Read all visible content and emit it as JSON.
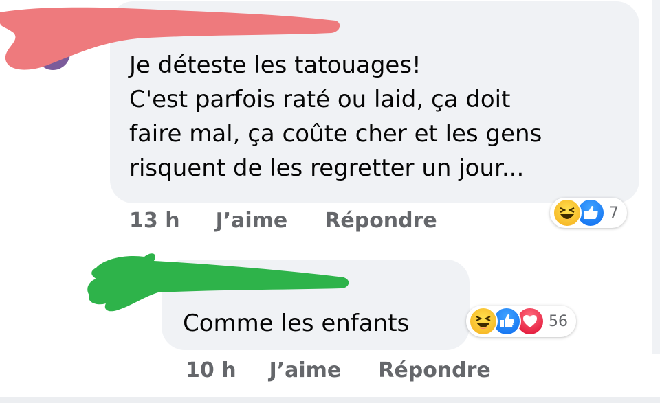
{
  "comments": [
    {
      "text": "Je déteste les tatouages!\nC'est parfois raté ou laid, ça doit\nfaire mal, ça coûte cher et les gens\nrisquent de les regretter un jour...",
      "time": "13 h",
      "like_label": "J’aime",
      "reply_label": "Répondre",
      "reactions": [
        "haha",
        "like"
      ],
      "reaction_count": "7"
    },
    {
      "text": "Comme les enfants",
      "time": "10 h",
      "like_label": "J’aime",
      "reply_label": "Répondre",
      "reactions": [
        "haha",
        "like",
        "love"
      ],
      "reaction_count": "56"
    }
  ],
  "colors": {
    "bubble_bg": "#f0f2f5",
    "meta_text": "#65676b",
    "redaction_1": "#ee7a7d",
    "redaction_2": "#2eb34a",
    "like_blue": "#1877f2",
    "love_red": "#e41e3f",
    "haha_yellow": "#f7b928"
  },
  "icons": {
    "haha": "haha-reaction-icon",
    "like": "like-reaction-icon",
    "love": "love-reaction-icon"
  }
}
